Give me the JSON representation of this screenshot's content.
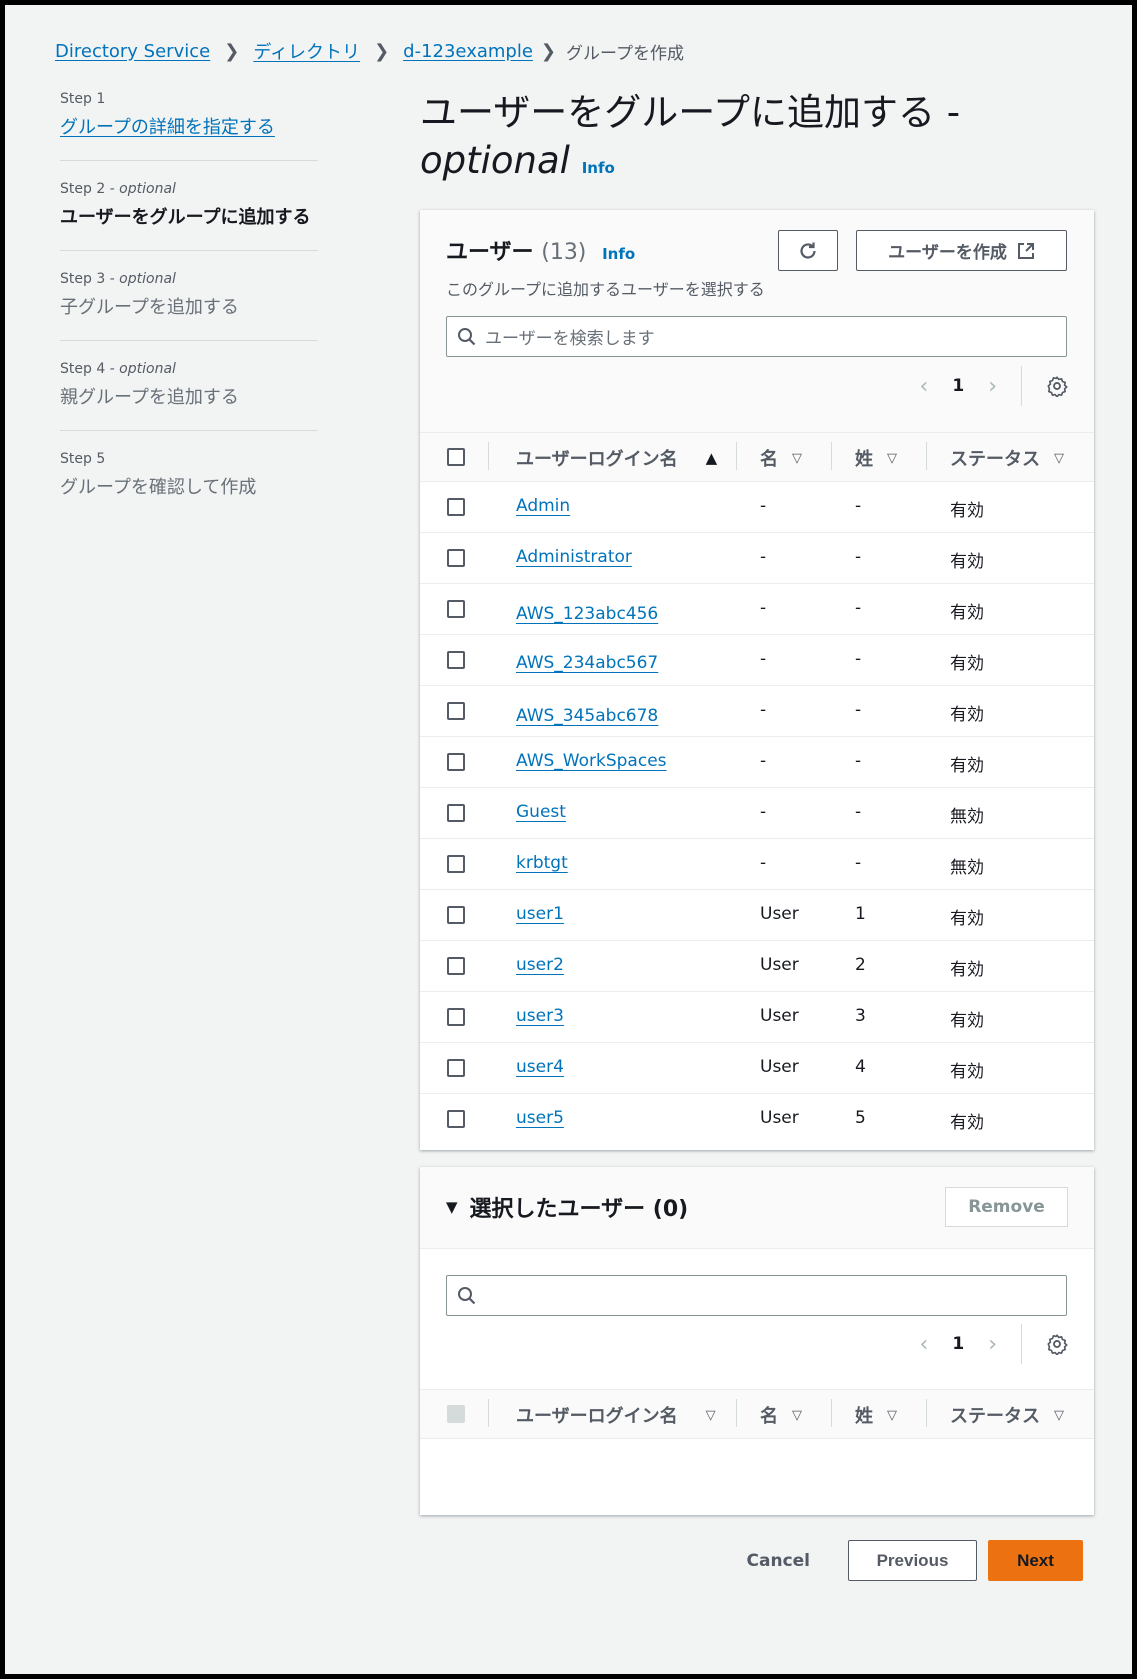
{
  "breadcrumb": {
    "items": [
      "Directory Service",
      "ディレクトリ",
      "d-123example"
    ],
    "current": "グループを作成"
  },
  "steps": [
    {
      "label": "Step 1",
      "optional": "",
      "title": "グループの詳細を指定する"
    },
    {
      "label": "Step 2",
      "optional": " - optional",
      "title": "ユーザーをグループに追加する"
    },
    {
      "label": "Step 3",
      "optional": " - optional",
      "title": "子グループを追加する"
    },
    {
      "label": "Step 4",
      "optional": " - optional",
      "title": "親グループを追加する"
    },
    {
      "label": "Step 5",
      "optional": "",
      "title": "グループを確認して作成"
    }
  ],
  "heading": {
    "title": "ユーザーをグループに追加する -",
    "optional": "optional",
    "info": "Info"
  },
  "users_panel": {
    "title": "ユーザー",
    "count": "(13)",
    "info": "Info",
    "description": "このグループに追加するユーザーを選択する",
    "create_button": "ユーザーを作成",
    "search_placeholder": "ユーザーを検索します",
    "page": "1",
    "columns": [
      "ユーザーログイン名",
      "名",
      "姓",
      "ステータス"
    ],
    "rows": [
      {
        "login": "Admin",
        "first": "-",
        "last": "-",
        "status": "有効"
      },
      {
        "login": "Administrator",
        "first": "-",
        "last": "-",
        "status": "有効"
      },
      {
        "login": "AWS_123abc456",
        "first": "-",
        "last": "-",
        "status": "有効"
      },
      {
        "login": "AWS_234abc567",
        "first": "-",
        "last": "-",
        "status": "有効"
      },
      {
        "login": "AWS_345abc678",
        "first": "-",
        "last": "-",
        "status": "有効"
      },
      {
        "login": "AWS_WorkSpaces",
        "first": "-",
        "last": "-",
        "status": "有効"
      },
      {
        "login": "Guest",
        "first": "-",
        "last": "-",
        "status": "無効"
      },
      {
        "login": "krbtgt",
        "first": "-",
        "last": "-",
        "status": "無効"
      },
      {
        "login": "user1",
        "first": "User",
        "last": "1",
        "status": "有効"
      },
      {
        "login": "user2",
        "first": "User",
        "last": "2",
        "status": "有効"
      },
      {
        "login": "user3",
        "first": "User",
        "last": "3",
        "status": "有効"
      },
      {
        "login": "user4",
        "first": "User",
        "last": "4",
        "status": "有効"
      },
      {
        "login": "user5",
        "first": "User",
        "last": "5",
        "status": "有効"
      }
    ]
  },
  "selected_panel": {
    "title": "選択したユーザー (0)",
    "remove_button": "Remove",
    "search_placeholder": "",
    "page": "1",
    "columns": [
      "ユーザーログイン名",
      "名",
      "姓",
      "ステータス"
    ]
  },
  "footer": {
    "cancel": "Cancel",
    "previous": "Previous",
    "next": "Next"
  },
  "colors": {
    "link": "#0073bb",
    "primary_button": "#ec7211",
    "background": "#f2f3f3"
  }
}
